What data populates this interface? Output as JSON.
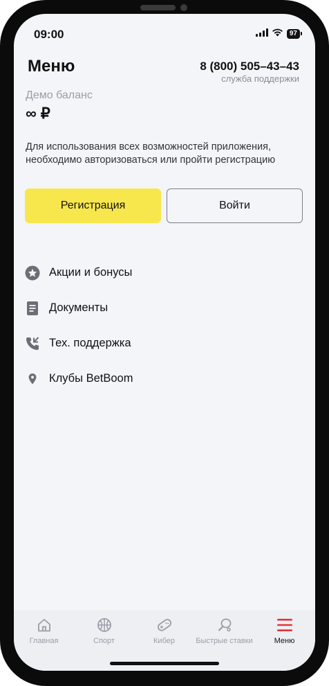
{
  "status": {
    "time": "09:00",
    "battery": "97"
  },
  "header": {
    "title": "Меню",
    "phone": "8 (800) 505–43–43",
    "phone_caption": "служба поддержки"
  },
  "demo": {
    "label": "Демо баланс",
    "value": "∞ ₽"
  },
  "auth": {
    "text": "Для использования всех возможностей приложения, необходимо авторизоваться или пройти регистрацию",
    "register_label": "Регистрация",
    "login_label": "Войти"
  },
  "menu": {
    "items": [
      {
        "label": "Акции и бонусы",
        "icon": "star-icon"
      },
      {
        "label": "Документы",
        "icon": "document-icon"
      },
      {
        "label": "Тех. поддержка",
        "icon": "phone-icon"
      },
      {
        "label": "Клубы BetBoom",
        "icon": "location-pin-icon"
      }
    ]
  },
  "tabbar": {
    "tabs": [
      {
        "label": "Главная",
        "icon": "home-icon"
      },
      {
        "label": "Спорт",
        "icon": "basketball-icon"
      },
      {
        "label": "Кибер",
        "icon": "gamepad-icon"
      },
      {
        "label": "Быстрые ставки",
        "icon": "racket-icon"
      },
      {
        "label": "Меню",
        "icon": "menu-icon",
        "active": true
      }
    ]
  },
  "colors": {
    "accent": "#f7e74d",
    "menu_active": "#e2363a",
    "background": "#f4f5f9"
  }
}
